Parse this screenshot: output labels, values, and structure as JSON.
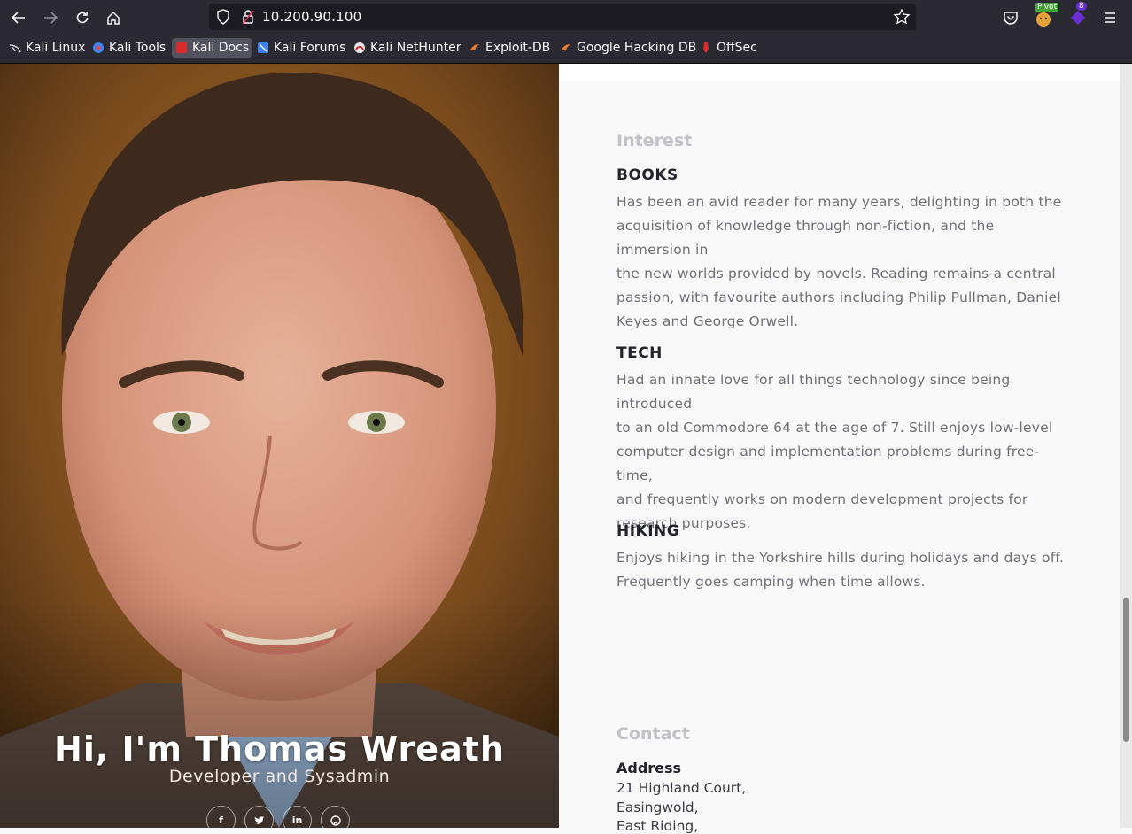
{
  "browser": {
    "url": "10.200.90.100",
    "extension_badge": "Pivot",
    "extension_count": "8",
    "bookmarks": [
      "Kali Linux",
      "Kali Tools",
      "Kali Docs",
      "Kali Forums",
      "Kali NetHunter",
      "Exploit-DB",
      "Google Hacking DB",
      "OffSec"
    ]
  },
  "hero": {
    "title": "Hi, I'm Thomas Wreath",
    "subtitle": "Developer and Sysadmin",
    "socials": [
      "facebook-icon",
      "twitter-icon",
      "linkedin-icon",
      "github-icon"
    ]
  },
  "interest": {
    "title": "Interest",
    "items": [
      {
        "heading": "BOOKS",
        "lines": [
          "Has been an avid reader for many years, delighting in both the",
          "acquisition of knowledge through non-fiction, and the immersion in",
          "the new worlds provided by novels. Reading remains a central",
          "passion, with favourite authors including Philip Pullman, Daniel",
          "Keyes and George Orwell."
        ]
      },
      {
        "heading": "TECH",
        "lines": [
          "Had an innate love for all things technology since being introduced",
          "to an old Commodore 64 at the age of 7. Still enjoys low-level",
          "computer design and implementation problems during free-time,",
          "and frequently works on modern development projects for",
          "research purposes."
        ]
      },
      {
        "heading": "HIKING",
        "lines": [
          "Enjoys hiking in the Yorkshire hills during holidays and days off.",
          "Frequently goes camping when time allows."
        ]
      }
    ]
  },
  "contact": {
    "title": "Contact",
    "address_label": "Address",
    "address_lines": [
      "21 Highland Court,",
      "Easingwold,",
      "East Riding,"
    ]
  }
}
